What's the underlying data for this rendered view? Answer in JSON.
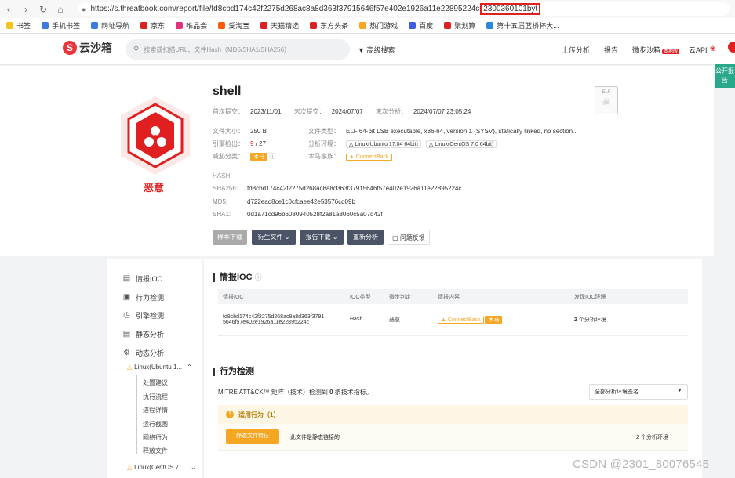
{
  "browser": {
    "url_main": "https://s.threatbook.com/report/file/fd8cbd174c42f2275d268ac8a8d363f37915646f57e402e1926a11e22895224c",
    "url_highlight": "2300360101byt",
    "bookmarks": [
      {
        "label": "书签",
        "color": "#f5c518"
      },
      {
        "label": "手机书签",
        "color": "#3b7be0"
      },
      {
        "label": "网址导航",
        "color": "#3b7be0"
      },
      {
        "label": "京东",
        "color": "#e02020"
      },
      {
        "label": "唯品会",
        "color": "#e0327a"
      },
      {
        "label": "爱淘宝",
        "color": "#ff5a00"
      },
      {
        "label": "天猫精选",
        "color": "#e02020"
      },
      {
        "label": "东方头条",
        "color": "#e02020"
      },
      {
        "label": "热门游戏",
        "color": "#f5a623"
      },
      {
        "label": "百度",
        "color": "#3b5fe0"
      },
      {
        "label": "聚划算",
        "color": "#e02020"
      },
      {
        "label": "第十五届蓝桥杯大...",
        "color": "#2b88d8"
      }
    ]
  },
  "header": {
    "logo_text": "云沙箱",
    "search_placeholder": "搜索或扫描URL、文件Hash（MD5/SHA1/SHA256）",
    "advanced_search": "高级搜索",
    "nav": {
      "upload": "上传分析",
      "report": "报告",
      "wechat_sandbox": "微步沙箱",
      "local_badge": "本地版",
      "cloud_api": "云API"
    },
    "public_report": "公开报告"
  },
  "summary": {
    "verdict": "恶意",
    "file_name": "shell",
    "first_submit_label": "首次提交：",
    "first_submit": "2023/11/01",
    "last_submit_label": "末次提交：",
    "last_submit": "2024/07/07",
    "last_analysis_label": "末次分析：",
    "last_analysis": "2024/07/07 23:05:24",
    "size_label": "文件大小：",
    "size": "250 B",
    "engine_label": "引擎检出：",
    "engine_hits": "9",
    "engine_total": "/ 27",
    "threat_label": "威胁分类：",
    "threat_type": "木马",
    "filetype_label": "文件类型：",
    "filetype": "ELF 64-bit LSB executable, x86-64, version 1 (SYSV), statically linked, no section...",
    "env_label": "分析环境：",
    "env1": "Linux(Ubuntu 17.04 64bit)",
    "env2": "Linux(CentOS 7.0 64bit)",
    "family_label": "木马家族：",
    "family": "ConnectBack",
    "hash_header": "HASH",
    "sha256_label": "SHA256:",
    "sha256": "fd8cbd174c42f2275d268ac8a8d363f37915646f57e402e1926a11e22895224c",
    "md5_label": "MD5:",
    "md5": "d722ead8ce1c0cfcaee42e53576cd09b",
    "sha1_label": "SHA1:",
    "sha1": "0d1a71cd96b6080940528f2a81a8060c5a07d42f",
    "buttons": {
      "download": "样本下载",
      "derived": "衍生文件",
      "report_dl": "报告下载",
      "reanalyze": "重新分析",
      "feedback": "问题反馈"
    },
    "elf_icon_label": "ELF"
  },
  "sidebar": {
    "items": [
      "情报IOC",
      "行为检测",
      "引擎检测",
      "静态分析",
      "动态分析"
    ],
    "env1": "Linux(Ubuntu 1...",
    "subitems": [
      "处置建议",
      "执行流程",
      "进程详情",
      "运行截图",
      "网络行为",
      "释放文件"
    ],
    "env2": "Linux(CentOS 7...."
  },
  "ioc": {
    "title": "情报IOC",
    "columns": [
      "情报IOC",
      "IOC类型",
      "微步判定",
      "情报内容",
      "发现IOC环境"
    ],
    "row": {
      "ioc_line1": "fd8cbd174c42f2275d268ac8a8d363f3791",
      "ioc_line2": "5646f57e402e1926a11e22895224c",
      "type": "Hash",
      "verdict": "恶意",
      "intel_family": "ConnectBack",
      "intel_tag": "木马",
      "env_count": "2",
      "env_text": "个分析环境"
    }
  },
  "behavior": {
    "title": "行为检测",
    "mitre_prefix": "MITRE ATT&CK™ 矩阵（技术）检测到",
    "mitre_count": "0",
    "mitre_suffix": "条技术指标。",
    "select_value": "全部分析环境签名",
    "applicable": "适用行为（1）",
    "behavior_tag": "静态文件特征",
    "behavior_desc": "此文件是静态链接的",
    "behavior_env": "2 个分析环境"
  },
  "watermark": "CSDN @2301_80076545"
}
